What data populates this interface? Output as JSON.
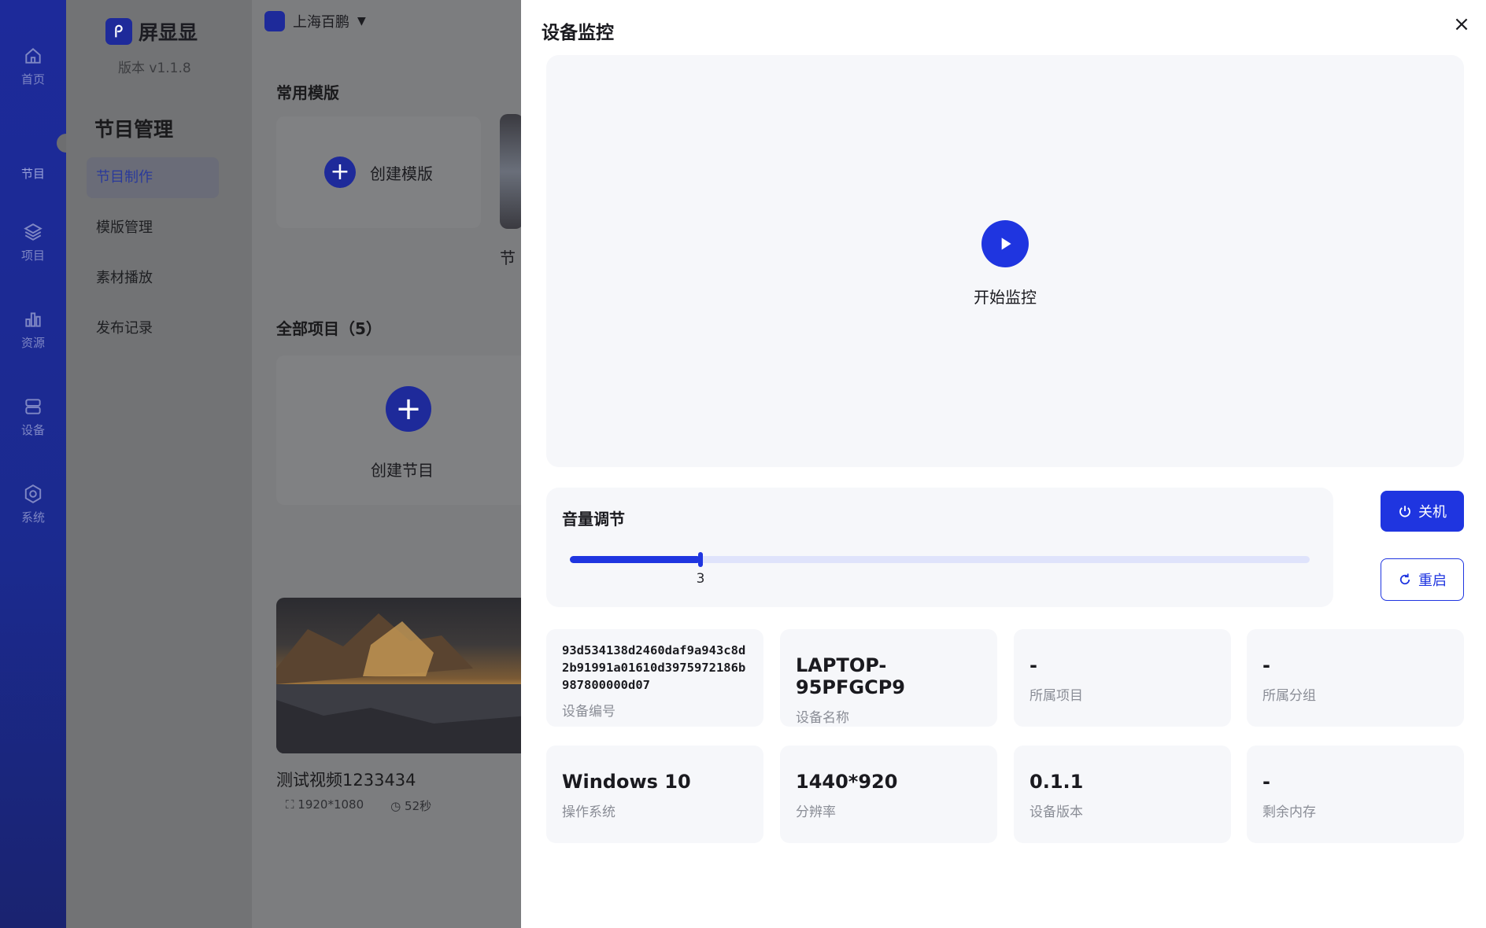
{
  "rail": {
    "items": [
      {
        "label": "首页",
        "icon": "home-icon"
      },
      {
        "label": "节目",
        "icon": "program-icon"
      },
      {
        "label": "项目",
        "icon": "layers-icon"
      },
      {
        "label": "资源",
        "icon": "bar-chart-icon"
      },
      {
        "label": "设备",
        "icon": "device-icon"
      },
      {
        "label": "系统",
        "icon": "settings-icon"
      }
    ]
  },
  "app": {
    "name": "屏显显",
    "version": "版本 v1.1.8"
  },
  "menu": {
    "title": "节目管理",
    "items": [
      {
        "label": "节目制作"
      },
      {
        "label": "模版管理"
      },
      {
        "label": "素材播放"
      },
      {
        "label": "发布记录"
      }
    ]
  },
  "topbar": {
    "org_name": "上海百鹏",
    "caret": "▼"
  },
  "main": {
    "templates_title": "常用模版",
    "create_template": "创建模版",
    "template_preview_caption": "节",
    "all_projects_title": "全部项目（5）",
    "create_program": "创建节目",
    "video": {
      "title": "测试视频1233434",
      "resolution": "1920*1080",
      "duration": "52秒"
    }
  },
  "modal": {
    "title": "设备监控",
    "close": "×",
    "start_monitor": "开始监控",
    "volume": {
      "title": "音量调节",
      "value": 3,
      "max": 17,
      "value_text": "3"
    },
    "shutdown_label": "关机",
    "restart_label": "重启",
    "info": [
      {
        "value": "93d534138d2460daf9a943c8d2b91991a01610d3975972186b987800000d07",
        "label": "设备编号"
      },
      {
        "value": "LAPTOP-95PFGCP9",
        "label": "设备名称"
      },
      {
        "value": "-",
        "label": "所属项目"
      },
      {
        "value": "-",
        "label": "所属分组"
      },
      {
        "value": "Windows 10",
        "label": "操作系统"
      },
      {
        "value": "1440*920",
        "label": "分辨率"
      },
      {
        "value": "0.1.1",
        "label": "设备版本"
      },
      {
        "value": "-",
        "label": "剩余内存"
      }
    ]
  },
  "colors": {
    "primary": "#1f35e0",
    "rail": "#1d2a9a"
  }
}
